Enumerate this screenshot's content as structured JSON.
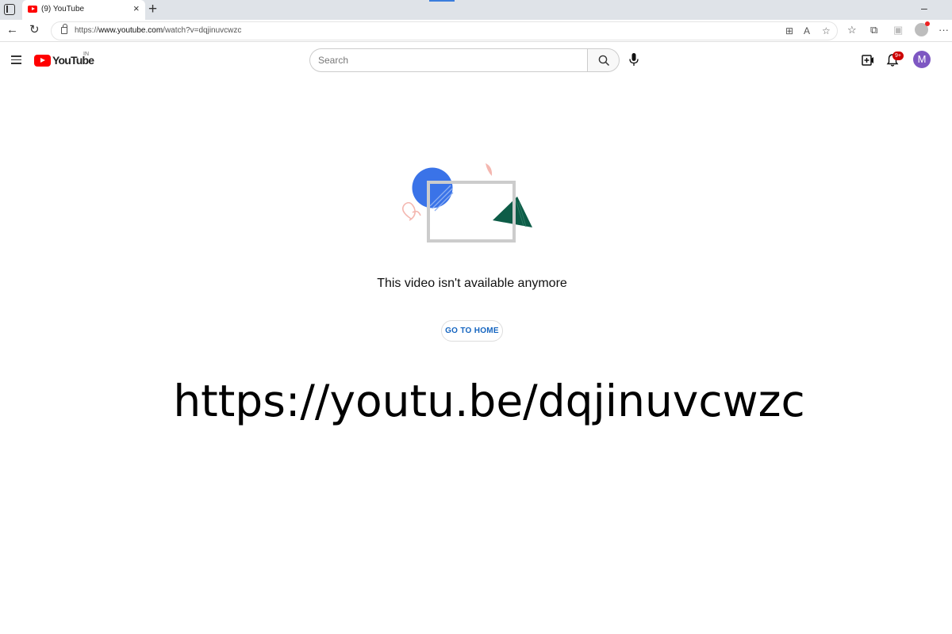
{
  "browser": {
    "tab": {
      "title": "(9) YouTube",
      "close_glyph": "×"
    },
    "new_tab_glyph": "+",
    "minimize_glyph": "–",
    "url_prefix": "https://",
    "url_host": "www.youtube.com",
    "url_path": "/watch?v=dqjinuvcwzc",
    "accent_color": "#3b7ddd"
  },
  "youtube": {
    "logo_text": "YouTube",
    "country_code": "IN",
    "search": {
      "placeholder": "Search"
    },
    "notifications": {
      "badge": "9+"
    },
    "avatar_initial": "M",
    "brand_color": "#ff0000"
  },
  "main": {
    "message": "This video isn't available anymore",
    "go_home_label": "GO TO HOME",
    "overlay_url": "https://youtu.be/dqjinuvcwzc"
  }
}
